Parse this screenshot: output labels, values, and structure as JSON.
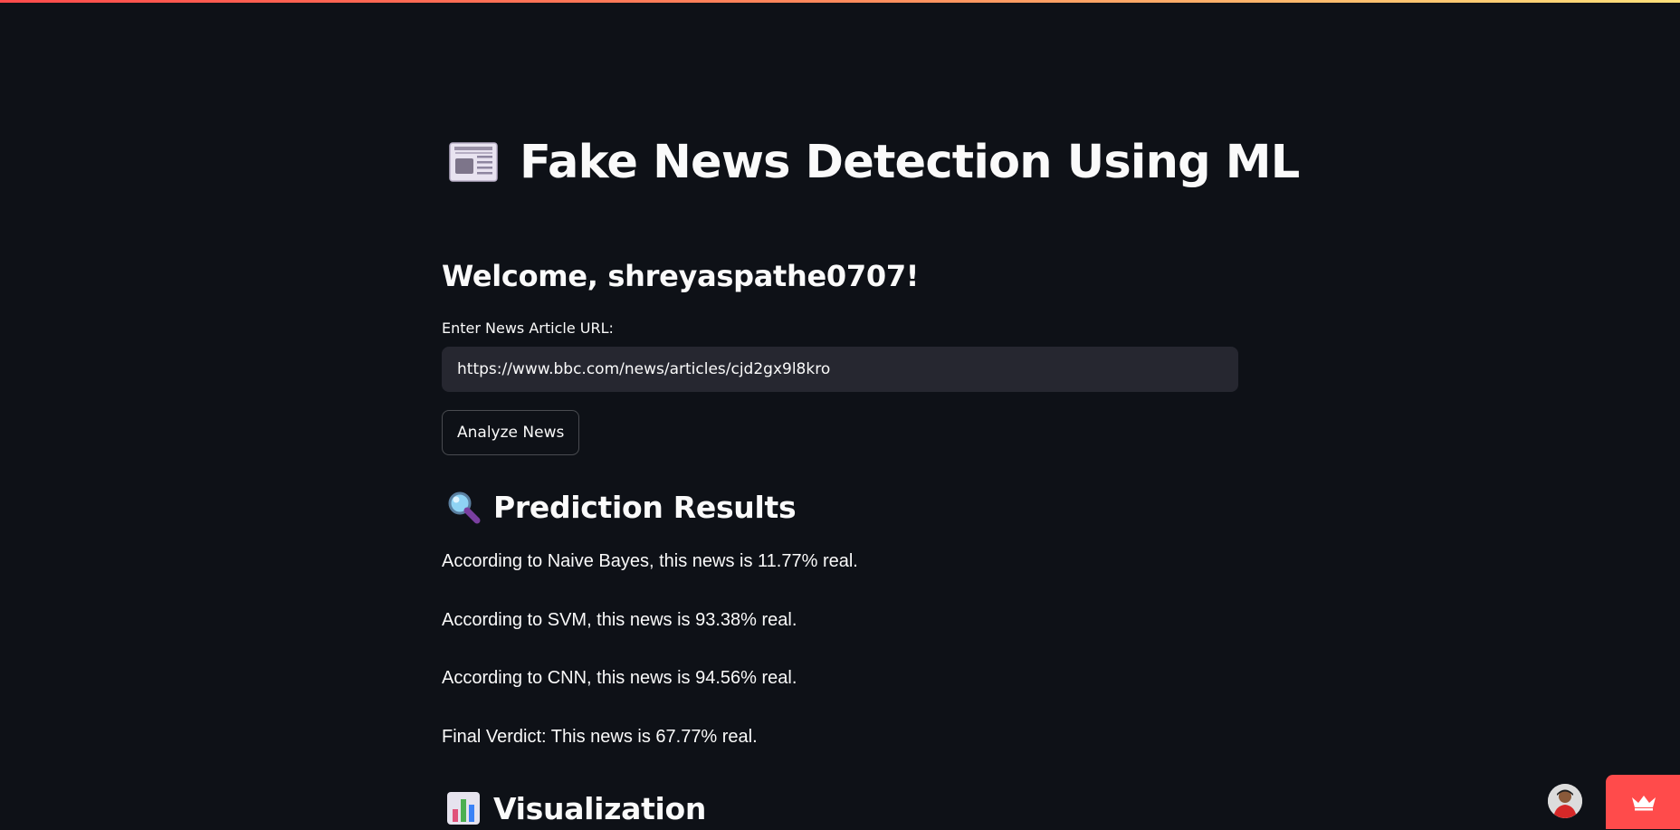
{
  "theme": {
    "background": "#0e1117",
    "text": "#fafafa",
    "input_bg": "#262730",
    "accent": "#ff4b4b"
  },
  "header": {
    "title": "Fake News Detection Using ML",
    "icon": "newspaper-icon"
  },
  "welcome": "Welcome, shreyaspathe0707!",
  "url_input": {
    "label": "Enter News Article URL:",
    "value": "https://www.bbc.com/news/articles/cjd2gx9l8kro"
  },
  "analyze_button": "Analyze News",
  "results": {
    "heading": "Prediction Results",
    "icon": "magnifier-icon",
    "lines": [
      "According to Naive Bayes, this news is 11.77% real.",
      "According to SVM, this news is 93.38% real.",
      "According to CNN, this news is 94.56% real.",
      "Final Verdict: This news is 67.77% real."
    ]
  },
  "visualization": {
    "heading": "Visualization",
    "icon": "bar-chart-icon"
  },
  "footer": {
    "avatar_icon": "user-avatar",
    "badge_icon": "crown-icon"
  }
}
